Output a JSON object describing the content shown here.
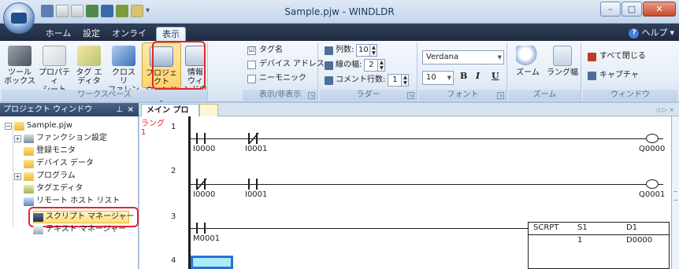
{
  "titlebar": {
    "title": "Sample.pjw - WINDLDR"
  },
  "ribbon_tabs": {
    "home": "ホーム",
    "settings": "設定",
    "online": "オンライン",
    "view": "表示",
    "help": "ヘルプ"
  },
  "ribbon": {
    "workspace": {
      "group_label": "ワークスペース",
      "toolbox": "ツール\nボックス",
      "property_sheet": "プロパティ\nシート",
      "tag_editor": "タグ エ\nディタ",
      "cross_reference": "クロス リ\nファレンス",
      "project_window": "プロジェクト\nウィンドウ",
      "info_window": "情報 ウィ\nンドウ"
    },
    "show_hide": {
      "group_label": "表示/非表示",
      "tag_name": "タグ名",
      "device_address": "デバイス アドレス",
      "mnemonic": "ニーモニック",
      "tag_name_checked": "☑",
      "device_address_checked": "☐",
      "mnemonic_checked": "☐"
    },
    "ladder": {
      "group_label": "ラダー",
      "columns_label": "列数:",
      "columns_value": "10",
      "line_width_label": "線の幅:",
      "line_width_value": "2",
      "comment_rows_label": "コメント行数:",
      "comment_rows_value": "1"
    },
    "font": {
      "group_label": "フォント",
      "font_name": "Verdana",
      "font_size": "10",
      "bold": "B",
      "italic": "I",
      "underline": "U"
    },
    "zoom": {
      "group_label": "ズーム",
      "zoom": "ズーム",
      "rung_width": "ラング幅"
    },
    "window": {
      "group_label": "ウィンドウ",
      "close_all": "すべて閉じる",
      "capture": "キャプチャ"
    }
  },
  "project_panel": {
    "title": "プロジェクト ウィンドウ",
    "pin": "ᵖ",
    "close": "×",
    "tree": [
      {
        "label": "Sample.pjw"
      },
      {
        "label": "ファンクション設定"
      },
      {
        "label": "登録モニタ"
      },
      {
        "label": "デバイス データ"
      },
      {
        "label": "プログラム"
      },
      {
        "label": "タグエディタ"
      },
      {
        "label": "リモート ホスト リスト"
      },
      {
        "label": "スクリプト マネージャー"
      },
      {
        "label": "テキスト マネージャー"
      }
    ]
  },
  "editor": {
    "tab_main": "メイン プログラム",
    "rung_caption": "ラング\n1",
    "rungs": [
      {
        "num": "1",
        "contacts": [
          "I0000",
          "I0001"
        ],
        "coil": "Q0000"
      },
      {
        "num": "2",
        "contacts": [
          "I0000",
          "I0001"
        ],
        "coil": "Q0001"
      },
      {
        "num": "3",
        "contacts": [
          "M0001"
        ],
        "block": {
          "name": "SCRPT",
          "s1_label": "S1",
          "s1_value": "1",
          "d1_label": "D1",
          "d1_value": "D0000"
        }
      },
      {
        "num": "4"
      }
    ]
  }
}
